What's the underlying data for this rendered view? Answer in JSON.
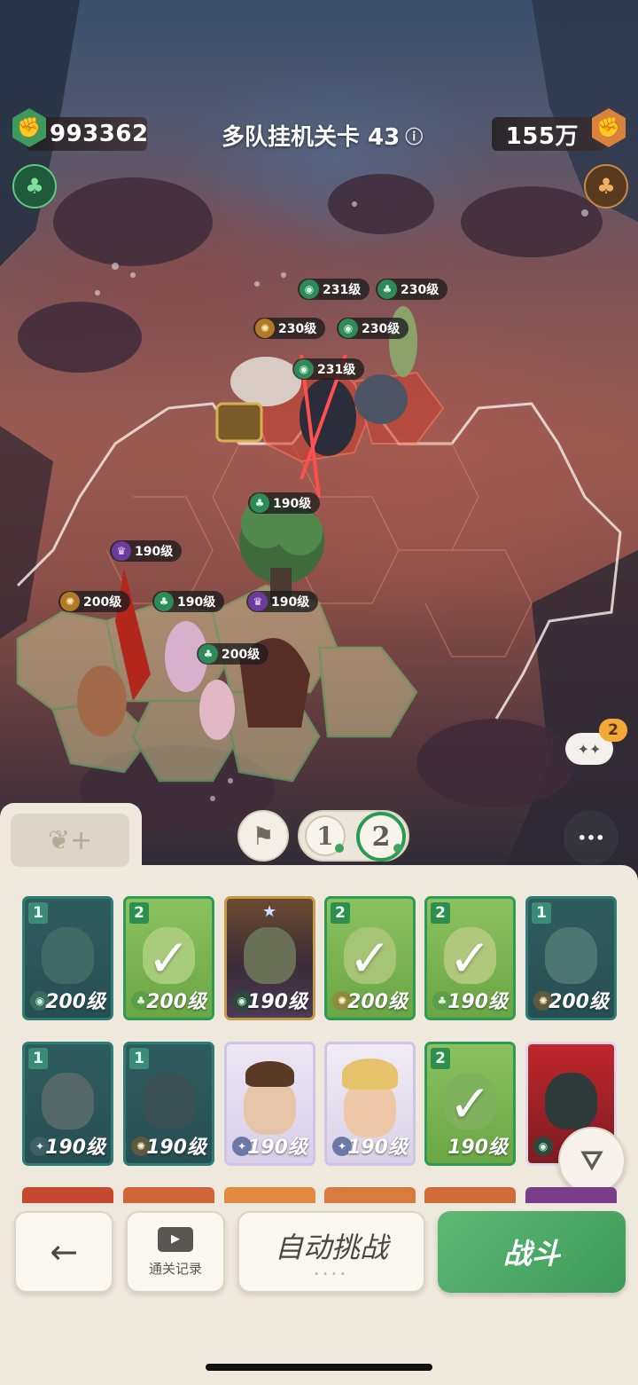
{
  "hud": {
    "left_power": "993362",
    "stage_title": "多队挂机关卡 43",
    "info_icon": "ⓘ",
    "right_power": "155万"
  },
  "enemies": [
    {
      "level": "231级",
      "faction": "green-eye"
    },
    {
      "level": "230级",
      "faction": "green-leaf"
    },
    {
      "level": "230级",
      "faction": "gold"
    },
    {
      "level": "230级",
      "faction": "green-eye"
    },
    {
      "level": "231级",
      "faction": "green-eye"
    }
  ],
  "allies": [
    {
      "level": "190级",
      "faction": "green-leaf"
    },
    {
      "level": "190级",
      "faction": "purple"
    },
    {
      "level": "200级",
      "faction": "gold"
    },
    {
      "level": "190级",
      "faction": "green-leaf"
    },
    {
      "level": "190级",
      "faction": "purple"
    },
    {
      "level": "200级",
      "faction": "green-leaf"
    }
  ],
  "chat_badge": "2",
  "team_tabs": [
    "1",
    "2"
  ],
  "cards_row1": [
    {
      "badge": "1",
      "level": "200级",
      "style": "dark",
      "checked": false
    },
    {
      "badge": "2",
      "level": "200级",
      "style": "green",
      "checked": true
    },
    {
      "badge": "",
      "level": "190级",
      "style": "hero-gold",
      "checked": false
    },
    {
      "badge": "2",
      "level": "200级",
      "style": "green",
      "checked": true
    },
    {
      "badge": "2",
      "level": "190级",
      "style": "green",
      "checked": true
    },
    {
      "badge": "1",
      "level": "200级",
      "style": "dark",
      "checked": false
    }
  ],
  "cards_row2": [
    {
      "badge": "1",
      "level": "190级",
      "style": "dark",
      "checked": false
    },
    {
      "badge": "1",
      "level": "190级",
      "style": "dark",
      "checked": false
    },
    {
      "badge": "",
      "level": "190级",
      "style": "hero-light",
      "checked": false
    },
    {
      "badge": "",
      "level": "190级",
      "style": "hero-light2",
      "checked": false
    },
    {
      "badge": "2",
      "level": "190级",
      "style": "green",
      "checked": true
    },
    {
      "badge": "",
      "level": "",
      "style": "hero-red",
      "checked": false
    }
  ],
  "buttons": {
    "back": "←",
    "replay_label": "通关记录",
    "auto_label": "自动挑战",
    "fight_label": "战斗",
    "more": "•••"
  }
}
